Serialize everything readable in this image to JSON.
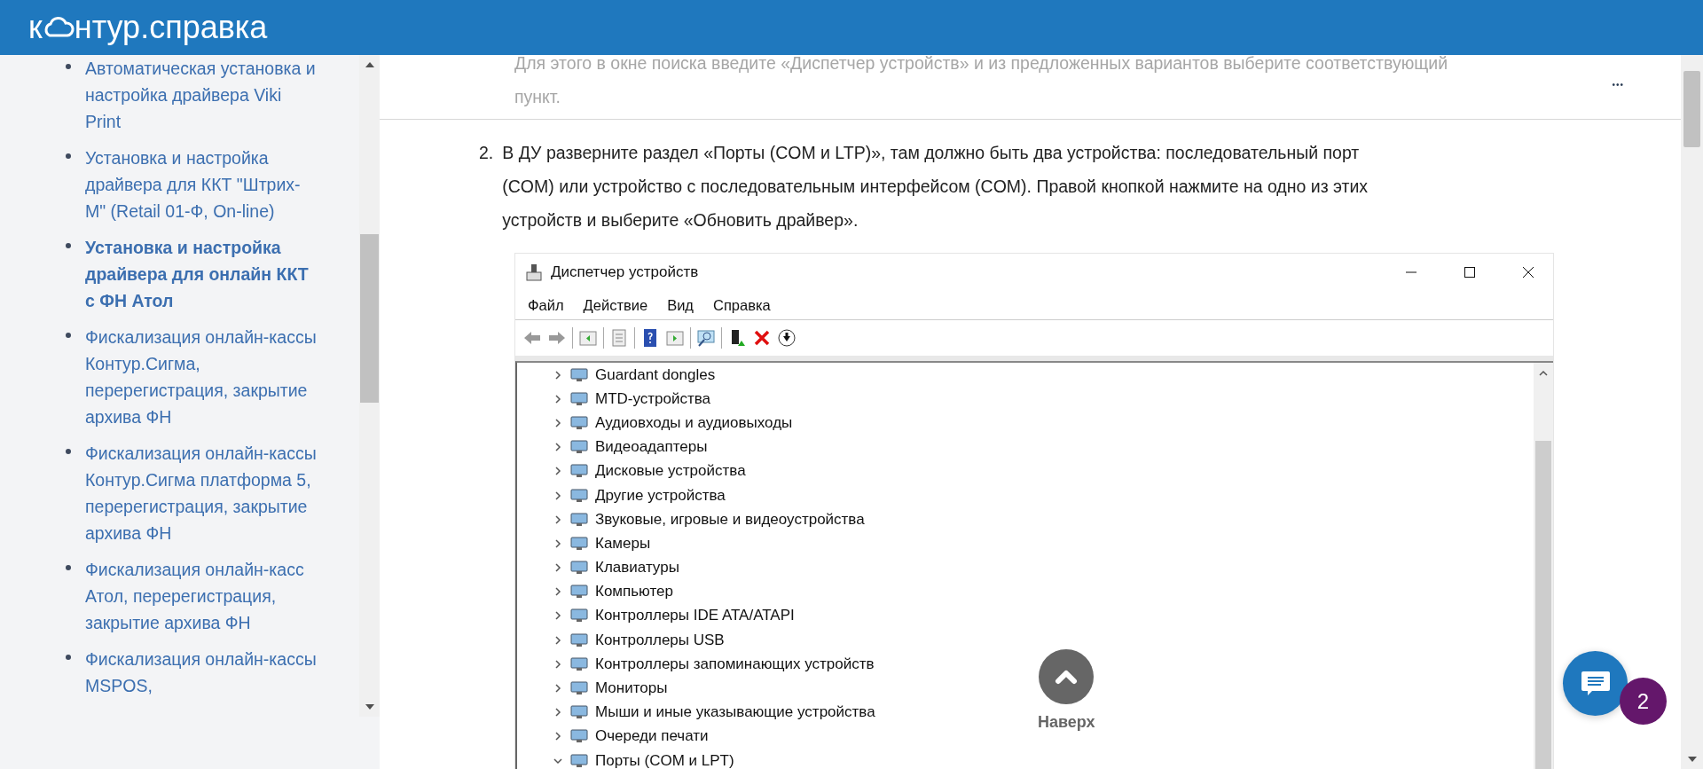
{
  "header": {
    "logo_start": "к",
    "logo_end": "нтур.справка"
  },
  "sidebar": {
    "items": [
      {
        "label": "Автоматическая установка и настройка драйвера Viki Print",
        "selected": false
      },
      {
        "label": "Установка и настройка драйвера для ККТ \"Штрих-М\" (Retail 01-Ф, On-line)",
        "selected": false
      },
      {
        "label": "Установка и настройка драйвера для онлайн ККТ с ФН Атол",
        "selected": true
      },
      {
        "label": "Фискализация онлайн-кассы Контур.Сигма, перерегистрация, закрытие архива ФН",
        "selected": false
      },
      {
        "label": "Фискализация онлайн-кассы Контур.Сигма платформа 5, перерегистрация, закрытие архива ФН",
        "selected": false
      },
      {
        "label": "Фискализация онлайн-касс Атол, перерегистрация, закрытие архива ФН",
        "selected": false
      },
      {
        "label": "Фискализация онлайн-кассы MSPOS,",
        "selected": false
      }
    ]
  },
  "article": {
    "faded_lines": [
      "Для этого в окне поиска введите «Диспетчер устройств» и из предложенных вариантов выберите соответствующий",
      "пункт."
    ],
    "more": "•••",
    "step": {
      "number": "2.",
      "text": "В ДУ разверните раздел «Порты (COM и LTP)», там должно быть два устройства: последовательный порт (COM) или устройство с последовательным интерфейсом (COM). Правой кнопкой нажмите на одно из этих устройств и выберите «Обновить драйвер»."
    }
  },
  "device_manager": {
    "title": "Диспетчер устройств",
    "menu": [
      "Файл",
      "Действие",
      "Вид",
      "Справка"
    ],
    "tree": [
      {
        "label": "Guardant dongles",
        "expanded": false
      },
      {
        "label": "MTD-устройства",
        "expanded": false
      },
      {
        "label": "Аудиовходы и аудиовыходы",
        "expanded": false
      },
      {
        "label": "Видеоадаптеры",
        "expanded": false
      },
      {
        "label": "Дисковые устройства",
        "expanded": false
      },
      {
        "label": "Другие устройства",
        "expanded": false
      },
      {
        "label": "Звуковые, игровые и видеоустройства",
        "expanded": false
      },
      {
        "label": "Камеры",
        "expanded": false
      },
      {
        "label": "Клавиатуры",
        "expanded": false
      },
      {
        "label": "Компьютер",
        "expanded": false
      },
      {
        "label": "Контроллеры IDE ATA/ATAPI",
        "expanded": false
      },
      {
        "label": "Контроллеры USB",
        "expanded": false
      },
      {
        "label": "Контроллеры запоминающих устройств",
        "expanded": false
      },
      {
        "label": "Мониторы",
        "expanded": false
      },
      {
        "label": "Мыши и иные указывающие устройства",
        "expanded": false
      },
      {
        "label": "Очереди печати",
        "expanded": false
      },
      {
        "label": "Порты (COM и LPT)",
        "expanded": true
      }
    ]
  },
  "scroll_top": {
    "label": "Наверх"
  },
  "chat": {
    "badge": "2"
  }
}
